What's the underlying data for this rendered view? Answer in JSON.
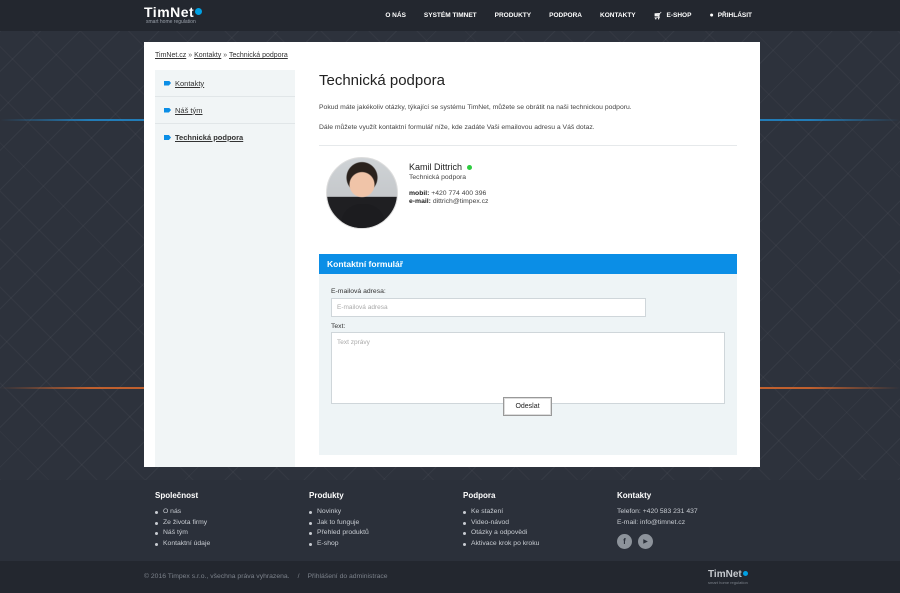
{
  "header": {
    "logo": "TimNet",
    "logo_sub": "smart home regulation",
    "nav": [
      {
        "label": "O NÁS"
      },
      {
        "label": "SYSTÉM TIMNET"
      },
      {
        "label": "PRODUKTY"
      },
      {
        "label": "PODPORA"
      },
      {
        "label": "KONTAKTY"
      },
      {
        "label": "E-SHOP",
        "icon": "cart-icon"
      },
      {
        "label": "PŘIHLÁSIT",
        "icon": "user-icon"
      }
    ]
  },
  "breadcrumb": {
    "items": [
      "TimNet.cz",
      "Kontakty",
      "Technická podpora"
    ],
    "separator": "»"
  },
  "sidebar": {
    "items": [
      {
        "label": "Kontakty",
        "active": false
      },
      {
        "label": "Náš tým",
        "active": false
      },
      {
        "label": "Technická podpora",
        "active": true
      }
    ]
  },
  "main": {
    "title": "Technická podpora",
    "intro": [
      "Pokud máte jakékoliv otázky, týkající se systému TimNet, můžete se obrátit na naši technickou podporu.",
      "Dále můžete využít kontaktní formulář níže, kde zadáte Vaši emailovou adresu a Váš dotaz."
    ],
    "contact": {
      "name": "Kamil Dittrich",
      "role": "Technická podpora",
      "phone_label": "mobil:",
      "phone": "+420 774 400 396",
      "email_label": "e-mail:",
      "email": "dittrich@timpex.cz",
      "status_color": "#2ecc40"
    },
    "form": {
      "title": "Kontaktní formulář",
      "email_label": "E-mailová adresa:",
      "email_placeholder": "E-mailová adresa",
      "text_label": "Text:",
      "text_placeholder": "Text zprávy",
      "submit": "Odeslat",
      "accent": "#0b8ee6"
    }
  },
  "footer": {
    "columns": [
      {
        "title": "Společnost",
        "items": [
          "O nás",
          "Ze života firmy",
          "Náš tým",
          "Kontaktní údaje"
        ]
      },
      {
        "title": "Produkty",
        "items": [
          "Novinky",
          "Jak to funguje",
          "Přehled produktů",
          "E-shop"
        ]
      },
      {
        "title": "Podpora",
        "items": [
          "Ke stažení",
          "Video-návod",
          "Otázky a odpovědi",
          "Aktivace krok po kroku"
        ]
      },
      {
        "title": "Kontakty",
        "lines": [
          "Telefon: +420 583 231 437",
          "E-mail: info@timnet.cz"
        ]
      }
    ],
    "social": [
      {
        "icon": "facebook-icon",
        "glyph": "f"
      },
      {
        "icon": "youtube-icon",
        "glyph": "▶"
      }
    ],
    "copyright": "© 2016 Timpex s.r.o., všechna práva vyhrazena.",
    "separator": "/",
    "admin_link": "Přihlášení do administrace",
    "logo": "TimNet",
    "logo_sub": "smart home regulation"
  }
}
